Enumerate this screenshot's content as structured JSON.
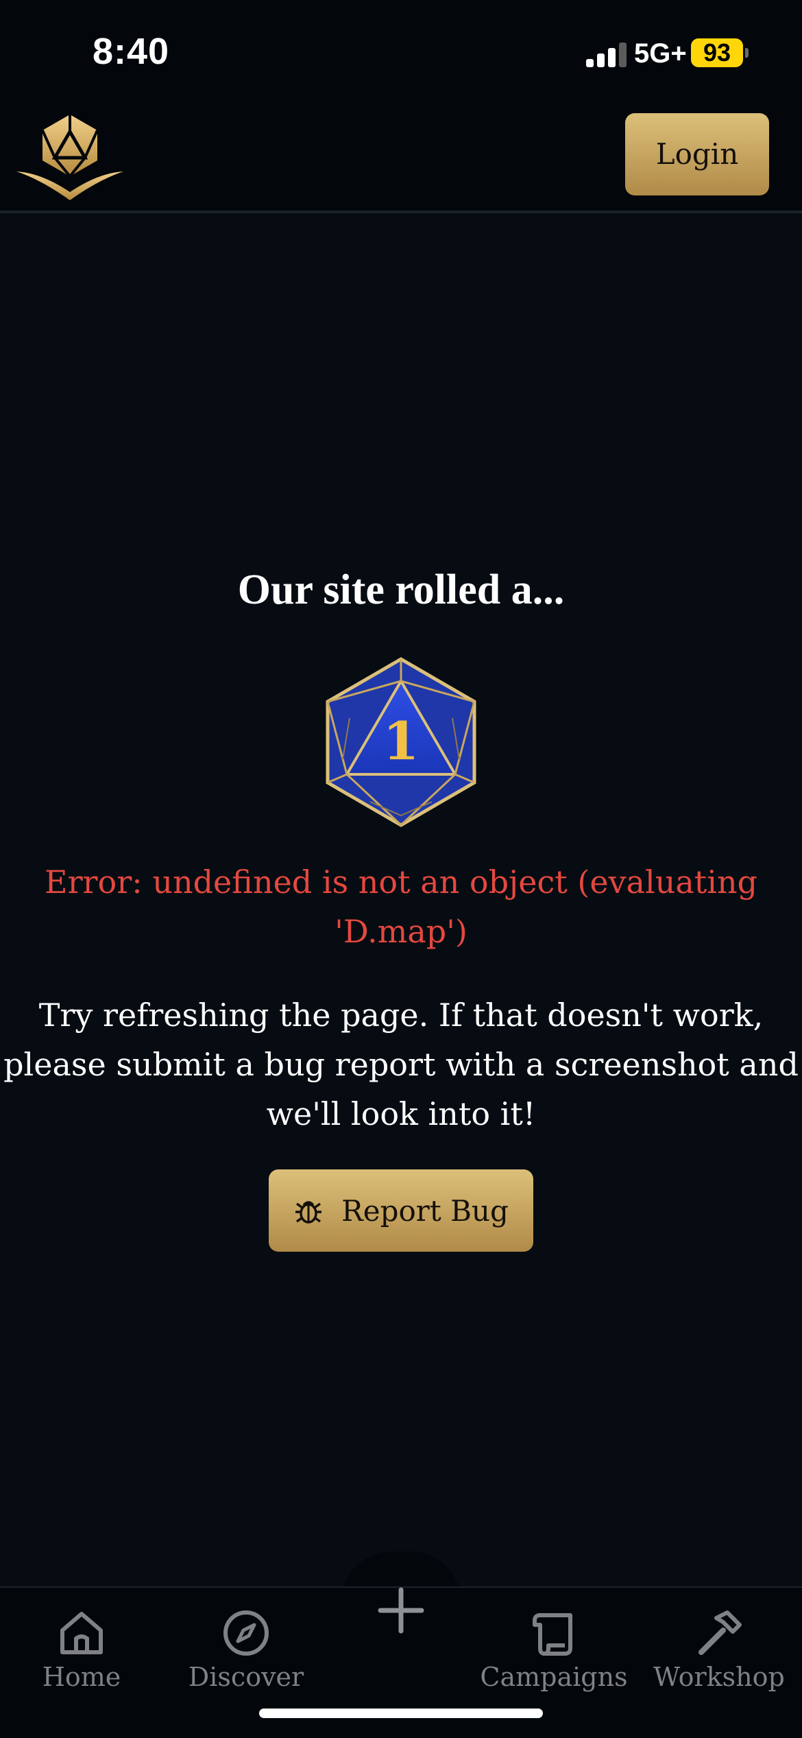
{
  "status_bar": {
    "time": "8:40",
    "network": "5G+",
    "battery": "93"
  },
  "header": {
    "login_label": "Login"
  },
  "main": {
    "title": "Our site rolled a...",
    "die_value": "1",
    "error": "Error: undefined is not an object (evaluating 'D.map')",
    "help": "Try refreshing the page. If that doesn't work, please submit a bug report with a screenshot and we'll look into it!",
    "report_label": "Report Bug"
  },
  "nav": {
    "items": [
      {
        "label": "Home",
        "icon": "home-icon"
      },
      {
        "label": "Discover",
        "icon": "compass-icon"
      },
      {
        "label": "Campaigns",
        "icon": "scroll-icon"
      },
      {
        "label": "Workshop",
        "icon": "hammer-icon"
      }
    ],
    "add_icon": "plus-icon"
  },
  "colors": {
    "accent_gold": "#c9a75f",
    "error_red": "#e5483f",
    "background": "#060c12",
    "die_blue": "#2344e0"
  }
}
